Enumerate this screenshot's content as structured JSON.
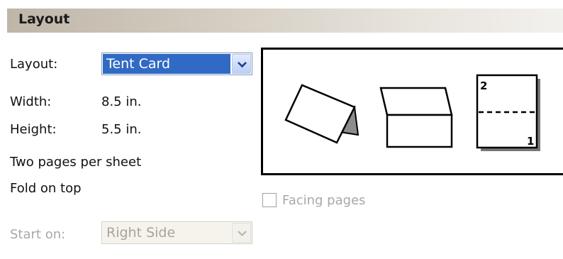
{
  "header": {
    "title": "Layout"
  },
  "layout": {
    "label": "Layout:",
    "selected": "Tent Card",
    "dropdown_icon": "chevron-down-icon"
  },
  "width": {
    "label": "Width:",
    "value": "8.5 in."
  },
  "height": {
    "label": "Height:",
    "value": "5.5 in."
  },
  "info": {
    "line1": "Two pages per sheet",
    "line2": "Fold on top"
  },
  "preview": {
    "page_number_top": "2",
    "page_number_bottom": "1",
    "icons": [
      "tent-card-icon",
      "fold-top-card-icon",
      "folded-page-icon"
    ]
  },
  "facing_pages": {
    "label": "Facing pages",
    "checked": false,
    "enabled": false
  },
  "start_on": {
    "label": "Start on:",
    "selected": "Right Side",
    "enabled": false
  },
  "colors": {
    "selection": "#316ac5",
    "header_gradient_start": "#bfb6a8",
    "disabled_text": "#a8a8a8"
  }
}
